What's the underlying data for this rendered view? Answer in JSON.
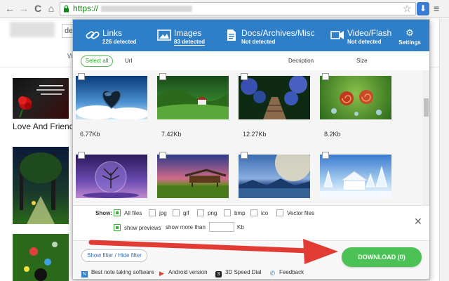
{
  "browser": {
    "url_scheme": "https://",
    "back_glyph": "←",
    "forward_glyph": "→",
    "reload_glyph": "C",
    "home_glyph": "⌂",
    "star_glyph": "☆",
    "menu_glyph": "≡",
    "ext_glyph": "⬇"
  },
  "page": {
    "search_prefix": "de",
    "w_label": "W",
    "caption": "Love And Friend"
  },
  "popup": {
    "tabs": [
      {
        "label": "Links",
        "status": "226 detected",
        "icon": "link-icon",
        "active": false
      },
      {
        "label": "Images",
        "status": "83 detected",
        "icon": "image-icon",
        "active": true
      },
      {
        "label": "Docs/Archives/Misc",
        "status": "Not detected",
        "icon": "document-icon",
        "active": false
      },
      {
        "label": "Video/Flash",
        "status": "Not detected",
        "icon": "video-icon",
        "active": false
      }
    ],
    "settings_label": "Settings",
    "settings_glyph": "⚙",
    "columns": {
      "select_all": "Select all",
      "url": "Url",
      "description": "Decription",
      "size": "Size"
    },
    "images": [
      {
        "size": "6.77Kb",
        "scene": "heart-clouds"
      },
      {
        "size": "7.42Kb",
        "scene": "green-valley"
      },
      {
        "size": "12.27Kb",
        "scene": "flower-path"
      },
      {
        "size": "8.2Kb",
        "scene": "snails"
      },
      {
        "size": "",
        "scene": "tree-sphere"
      },
      {
        "size": "",
        "scene": "sunset-hut"
      },
      {
        "size": "",
        "scene": "planet-lake"
      },
      {
        "size": "",
        "scene": "snow-house"
      }
    ],
    "filters": {
      "show_label": "Show:",
      "all_files": "All files",
      "jpg": "jpg",
      "gif": "gif",
      "png": "png",
      "bmp": "bmp",
      "ico": "ico",
      "vector": "Vector files",
      "show_previews": "show previews",
      "show_more_than": "show more than",
      "unit": "Kb",
      "all_files_checked": true,
      "show_previews_checked": true
    },
    "close_glyph": "✕",
    "filter_toggle": "Show filter / Hide filter",
    "download_label": "DOWNLOAD (0)",
    "footer_links": [
      {
        "label": "Best note taking software",
        "icon": "note-icon",
        "glyph": "N"
      },
      {
        "label": "Android version",
        "icon": "play-store-icon",
        "glyph": "▶"
      },
      {
        "label": "3D Speed Dial",
        "icon": "speed-dial-icon",
        "glyph": "3"
      },
      {
        "label": "Feedback",
        "icon": "feedback-icon",
        "glyph": "✆"
      }
    ]
  },
  "colors": {
    "header_blue": "#2f7fc8",
    "download_green": "#4cc155",
    "arrow_red": "#e23b34"
  }
}
